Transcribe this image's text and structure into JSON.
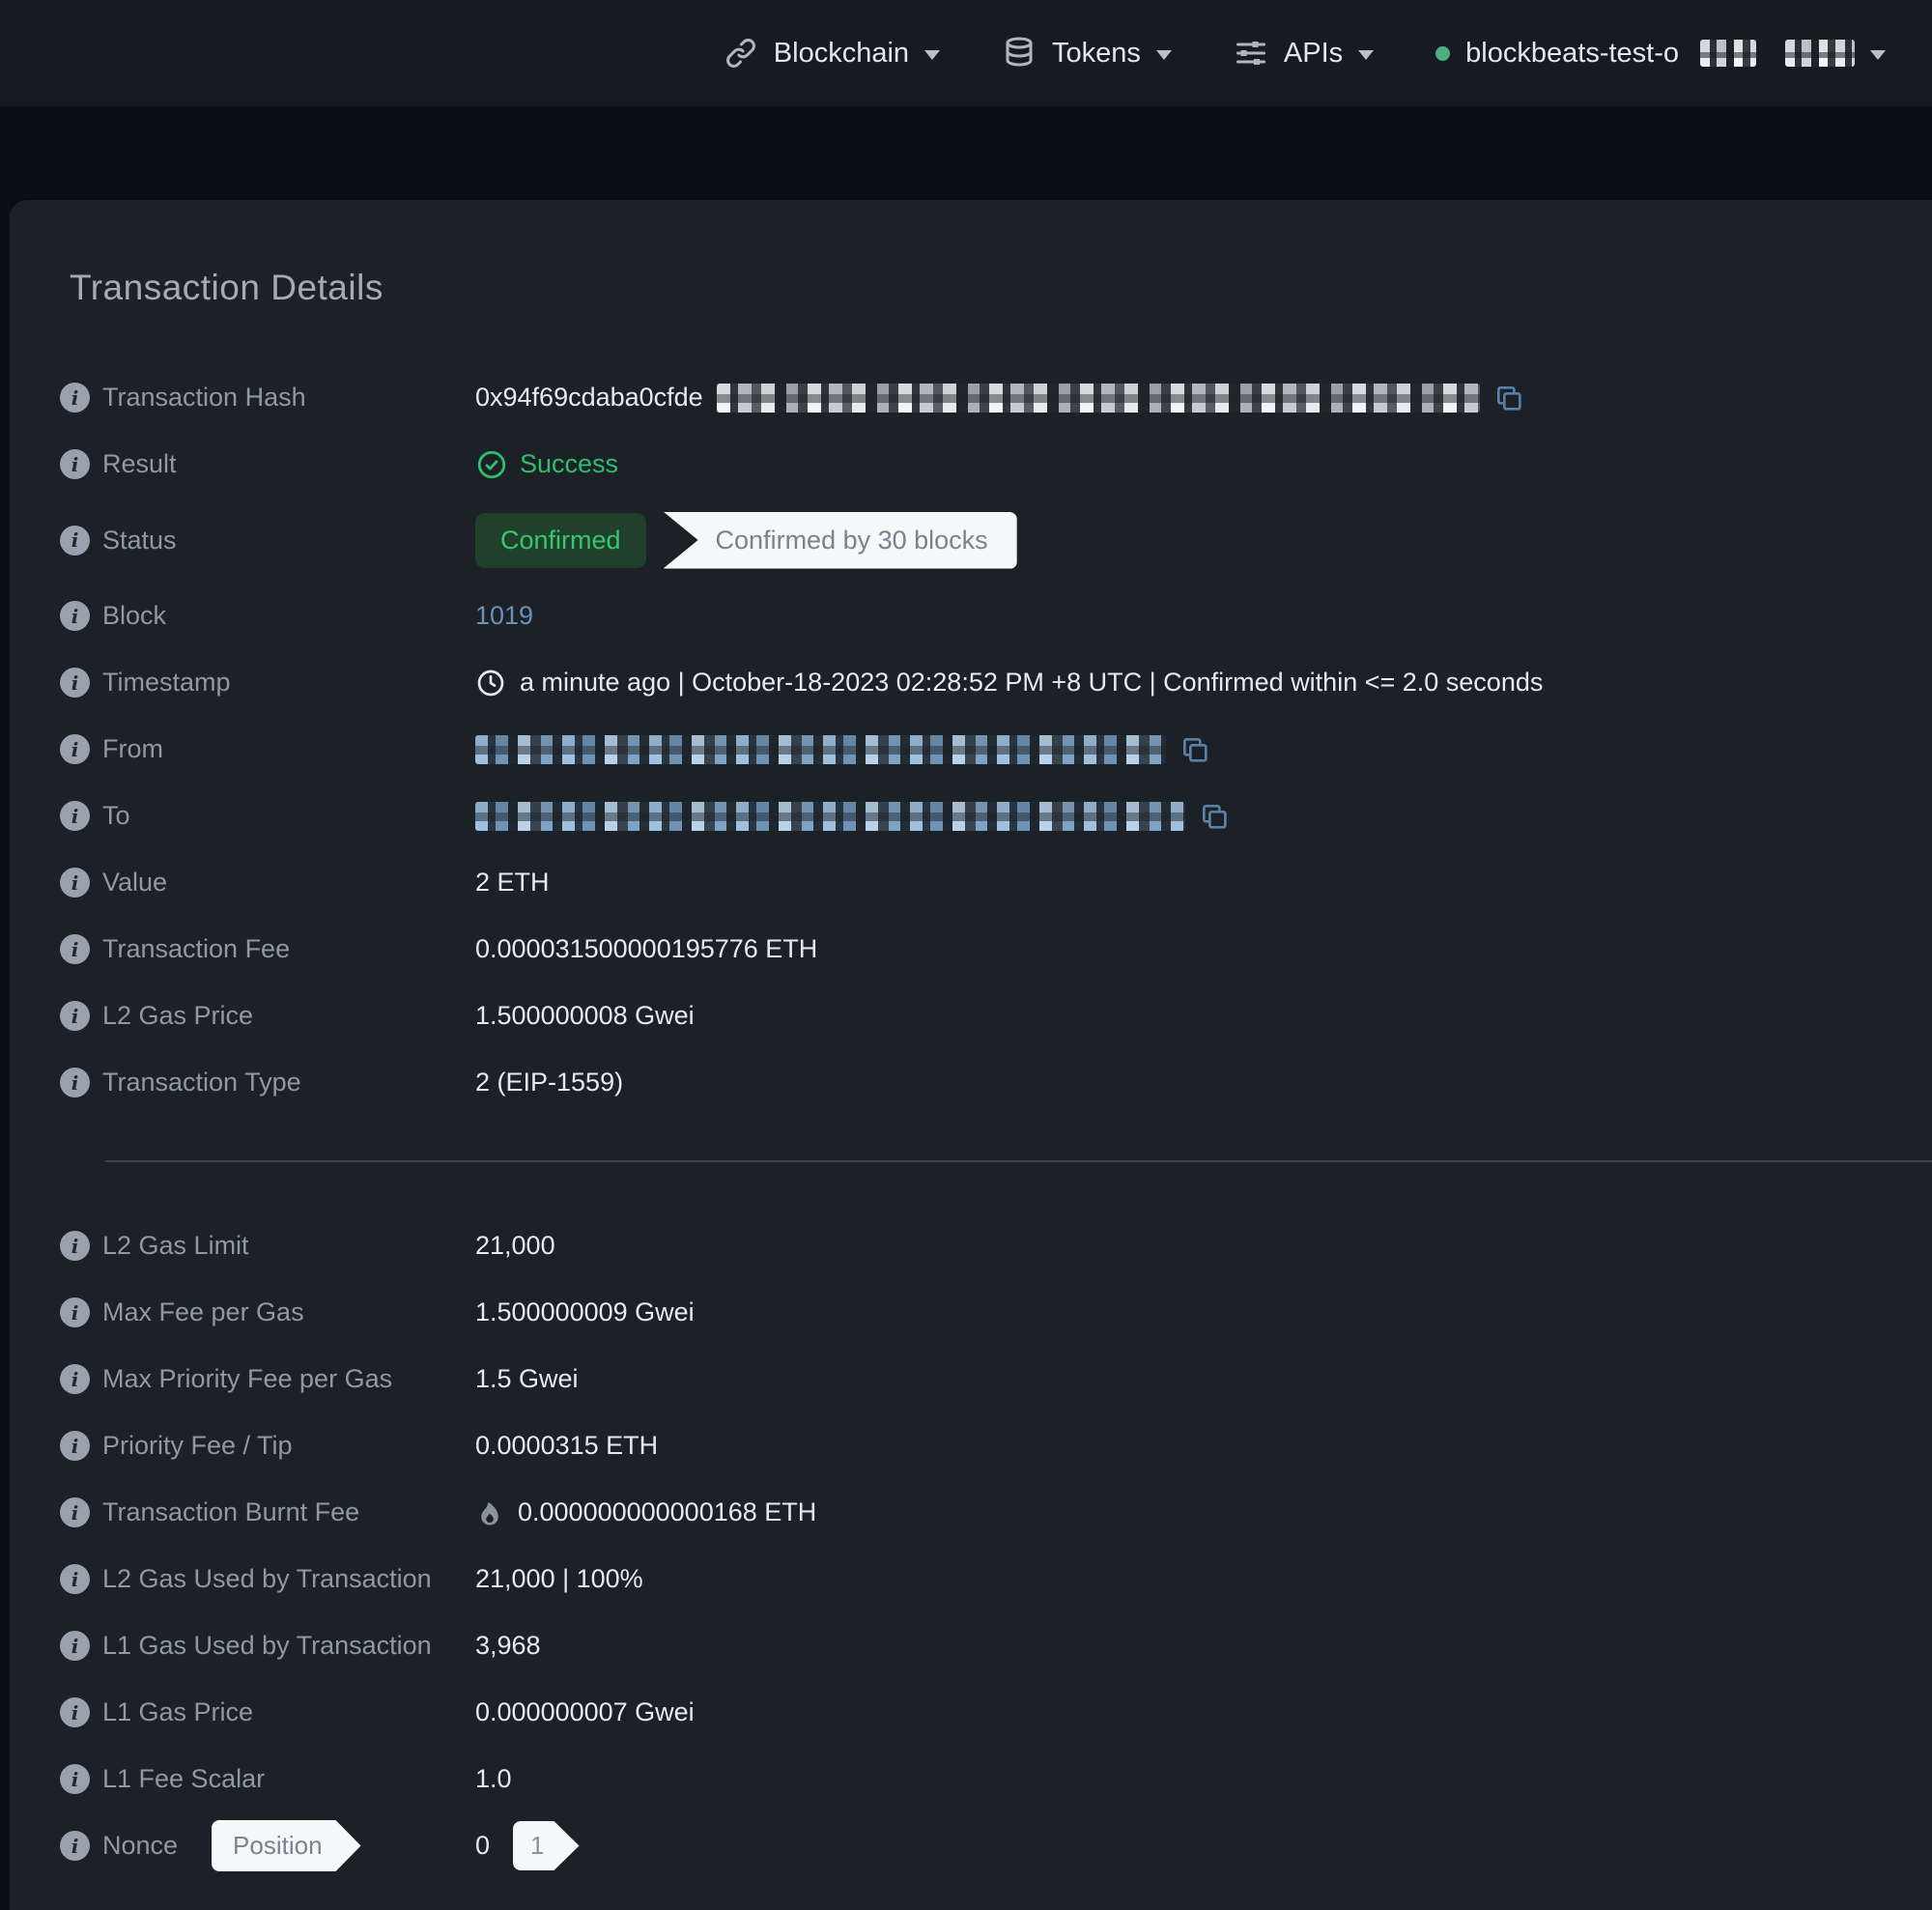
{
  "nav": {
    "blockchain": "Blockchain",
    "tokens": "Tokens",
    "apis": "APIs",
    "network_name": "blockbeats-test-o",
    "network_status_color": "#4caf7d"
  },
  "page": {
    "title": "Transaction Details"
  },
  "details": {
    "tx_hash": {
      "label": "Transaction Hash",
      "visible_value": "0x94f69cdaba0cfde"
    },
    "result": {
      "label": "Result",
      "value": "Success"
    },
    "status": {
      "label": "Status",
      "badge": "Confirmed",
      "confirmation_text": "Confirmed by 30 blocks"
    },
    "block": {
      "label": "Block",
      "value": "1019"
    },
    "timestamp": {
      "label": "Timestamp",
      "value": "a minute ago | October-18-2023 02:28:52 PM +8 UTC | Confirmed within <= 2.0 seconds"
    },
    "from": {
      "label": "From"
    },
    "to": {
      "label": "To"
    },
    "value": {
      "label": "Value",
      "value": "2 ETH"
    },
    "transaction_fee": {
      "label": "Transaction Fee",
      "value": "0.000031500000195776 ETH"
    },
    "l2_gas_price": {
      "label": "L2 Gas Price",
      "value": "1.500000008 Gwei"
    },
    "transaction_type": {
      "label": "Transaction Type",
      "value": "2 (EIP-1559)"
    }
  },
  "more_details": {
    "l2_gas_limit": {
      "label": "L2 Gas Limit",
      "value": "21,000"
    },
    "max_fee_per_gas": {
      "label": "Max Fee per Gas",
      "value": "1.500000009 Gwei"
    },
    "max_priority_fee_per_gas": {
      "label": "Max Priority Fee per Gas",
      "value": "1.5 Gwei"
    },
    "priority_fee_tip": {
      "label": "Priority Fee / Tip",
      "value": "0.0000315 ETH"
    },
    "transaction_burnt_fee": {
      "label": "Transaction Burnt Fee",
      "value": "0.000000000000168 ETH"
    },
    "l2_gas_used": {
      "label": "L2 Gas Used by Transaction",
      "value": "21,000 | 100%"
    },
    "l1_gas_used": {
      "label": "L1 Gas Used by Transaction",
      "value": "3,968"
    },
    "l1_gas_price": {
      "label": "L1 Gas Price",
      "value": "0.000000007 Gwei"
    },
    "l1_fee_scalar": {
      "label": "L1 Fee Scalar",
      "value": "1.0"
    },
    "nonce": {
      "label": "Nonce",
      "tag": "Position",
      "value": "0",
      "position_value": "1"
    }
  },
  "colors": {
    "success_green": "#2fbf6b",
    "link_blue": "#6b91b8",
    "confirmed_badge_bg": "#21402c",
    "confirmed_badge_text": "#34c76b",
    "card_bg": "#1b2127",
    "navbar_bg": "#171b21"
  }
}
